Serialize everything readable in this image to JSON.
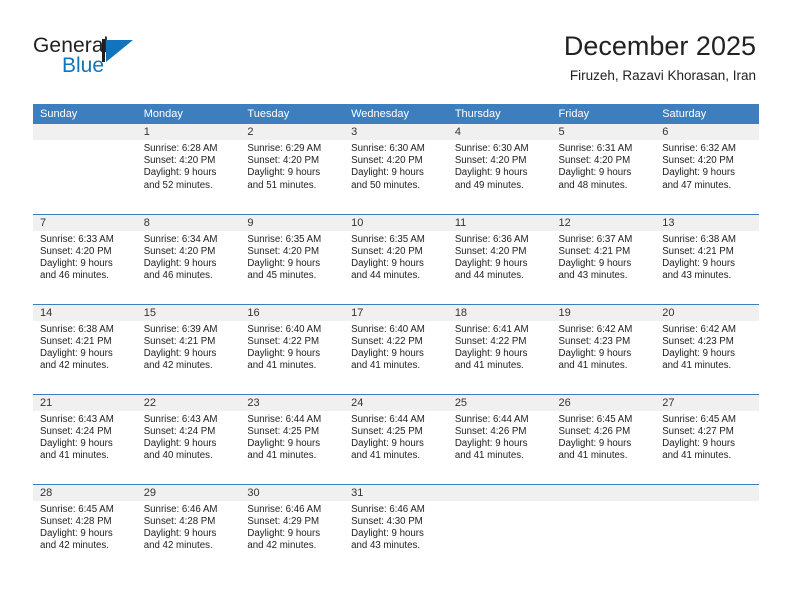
{
  "logo": {
    "word_top": "General",
    "word_bottom": "Blue",
    "brand_color": "#1274bc"
  },
  "header": {
    "title": "December 2025",
    "subtitle": "Firuzeh, Razavi Khorasan, Iran"
  },
  "theme": {
    "header_blue": "#3d7ebf",
    "daynum_band": "#f0f0f0",
    "text": "#222222"
  },
  "calendar": {
    "weekday_headers": [
      "Sunday",
      "Monday",
      "Tuesday",
      "Wednesday",
      "Thursday",
      "Friday",
      "Saturday"
    ],
    "weeks": [
      [
        {
          "day": "",
          "sunrise": "",
          "sunset": "",
          "daylight_1": "",
          "daylight_2": ""
        },
        {
          "day": "1",
          "sunrise": "Sunrise: 6:28 AM",
          "sunset": "Sunset: 4:20 PM",
          "daylight_1": "Daylight: 9 hours",
          "daylight_2": "and 52 minutes."
        },
        {
          "day": "2",
          "sunrise": "Sunrise: 6:29 AM",
          "sunset": "Sunset: 4:20 PM",
          "daylight_1": "Daylight: 9 hours",
          "daylight_2": "and 51 minutes."
        },
        {
          "day": "3",
          "sunrise": "Sunrise: 6:30 AM",
          "sunset": "Sunset: 4:20 PM",
          "daylight_1": "Daylight: 9 hours",
          "daylight_2": "and 50 minutes."
        },
        {
          "day": "4",
          "sunrise": "Sunrise: 6:30 AM",
          "sunset": "Sunset: 4:20 PM",
          "daylight_1": "Daylight: 9 hours",
          "daylight_2": "and 49 minutes."
        },
        {
          "day": "5",
          "sunrise": "Sunrise: 6:31 AM",
          "sunset": "Sunset: 4:20 PM",
          "daylight_1": "Daylight: 9 hours",
          "daylight_2": "and 48 minutes."
        },
        {
          "day": "6",
          "sunrise": "Sunrise: 6:32 AM",
          "sunset": "Sunset: 4:20 PM",
          "daylight_1": "Daylight: 9 hours",
          "daylight_2": "and 47 minutes."
        }
      ],
      [
        {
          "day": "7",
          "sunrise": "Sunrise: 6:33 AM",
          "sunset": "Sunset: 4:20 PM",
          "daylight_1": "Daylight: 9 hours",
          "daylight_2": "and 46 minutes."
        },
        {
          "day": "8",
          "sunrise": "Sunrise: 6:34 AM",
          "sunset": "Sunset: 4:20 PM",
          "daylight_1": "Daylight: 9 hours",
          "daylight_2": "and 46 minutes."
        },
        {
          "day": "9",
          "sunrise": "Sunrise: 6:35 AM",
          "sunset": "Sunset: 4:20 PM",
          "daylight_1": "Daylight: 9 hours",
          "daylight_2": "and 45 minutes."
        },
        {
          "day": "10",
          "sunrise": "Sunrise: 6:35 AM",
          "sunset": "Sunset: 4:20 PM",
          "daylight_1": "Daylight: 9 hours",
          "daylight_2": "and 44 minutes."
        },
        {
          "day": "11",
          "sunrise": "Sunrise: 6:36 AM",
          "sunset": "Sunset: 4:20 PM",
          "daylight_1": "Daylight: 9 hours",
          "daylight_2": "and 44 minutes."
        },
        {
          "day": "12",
          "sunrise": "Sunrise: 6:37 AM",
          "sunset": "Sunset: 4:21 PM",
          "daylight_1": "Daylight: 9 hours",
          "daylight_2": "and 43 minutes."
        },
        {
          "day": "13",
          "sunrise": "Sunrise: 6:38 AM",
          "sunset": "Sunset: 4:21 PM",
          "daylight_1": "Daylight: 9 hours",
          "daylight_2": "and 43 minutes."
        }
      ],
      [
        {
          "day": "14",
          "sunrise": "Sunrise: 6:38 AM",
          "sunset": "Sunset: 4:21 PM",
          "daylight_1": "Daylight: 9 hours",
          "daylight_2": "and 42 minutes."
        },
        {
          "day": "15",
          "sunrise": "Sunrise: 6:39 AM",
          "sunset": "Sunset: 4:21 PM",
          "daylight_1": "Daylight: 9 hours",
          "daylight_2": "and 42 minutes."
        },
        {
          "day": "16",
          "sunrise": "Sunrise: 6:40 AM",
          "sunset": "Sunset: 4:22 PM",
          "daylight_1": "Daylight: 9 hours",
          "daylight_2": "and 41 minutes."
        },
        {
          "day": "17",
          "sunrise": "Sunrise: 6:40 AM",
          "sunset": "Sunset: 4:22 PM",
          "daylight_1": "Daylight: 9 hours",
          "daylight_2": "and 41 minutes."
        },
        {
          "day": "18",
          "sunrise": "Sunrise: 6:41 AM",
          "sunset": "Sunset: 4:22 PM",
          "daylight_1": "Daylight: 9 hours",
          "daylight_2": "and 41 minutes."
        },
        {
          "day": "19",
          "sunrise": "Sunrise: 6:42 AM",
          "sunset": "Sunset: 4:23 PM",
          "daylight_1": "Daylight: 9 hours",
          "daylight_2": "and 41 minutes."
        },
        {
          "day": "20",
          "sunrise": "Sunrise: 6:42 AM",
          "sunset": "Sunset: 4:23 PM",
          "daylight_1": "Daylight: 9 hours",
          "daylight_2": "and 41 minutes."
        }
      ],
      [
        {
          "day": "21",
          "sunrise": "Sunrise: 6:43 AM",
          "sunset": "Sunset: 4:24 PM",
          "daylight_1": "Daylight: 9 hours",
          "daylight_2": "and 41 minutes."
        },
        {
          "day": "22",
          "sunrise": "Sunrise: 6:43 AM",
          "sunset": "Sunset: 4:24 PM",
          "daylight_1": "Daylight: 9 hours",
          "daylight_2": "and 40 minutes."
        },
        {
          "day": "23",
          "sunrise": "Sunrise: 6:44 AM",
          "sunset": "Sunset: 4:25 PM",
          "daylight_1": "Daylight: 9 hours",
          "daylight_2": "and 41 minutes."
        },
        {
          "day": "24",
          "sunrise": "Sunrise: 6:44 AM",
          "sunset": "Sunset: 4:25 PM",
          "daylight_1": "Daylight: 9 hours",
          "daylight_2": "and 41 minutes."
        },
        {
          "day": "25",
          "sunrise": "Sunrise: 6:44 AM",
          "sunset": "Sunset: 4:26 PM",
          "daylight_1": "Daylight: 9 hours",
          "daylight_2": "and 41 minutes."
        },
        {
          "day": "26",
          "sunrise": "Sunrise: 6:45 AM",
          "sunset": "Sunset: 4:26 PM",
          "daylight_1": "Daylight: 9 hours",
          "daylight_2": "and 41 minutes."
        },
        {
          "day": "27",
          "sunrise": "Sunrise: 6:45 AM",
          "sunset": "Sunset: 4:27 PM",
          "daylight_1": "Daylight: 9 hours",
          "daylight_2": "and 41 minutes."
        }
      ],
      [
        {
          "day": "28",
          "sunrise": "Sunrise: 6:45 AM",
          "sunset": "Sunset: 4:28 PM",
          "daylight_1": "Daylight: 9 hours",
          "daylight_2": "and 42 minutes."
        },
        {
          "day": "29",
          "sunrise": "Sunrise: 6:46 AM",
          "sunset": "Sunset: 4:28 PM",
          "daylight_1": "Daylight: 9 hours",
          "daylight_2": "and 42 minutes."
        },
        {
          "day": "30",
          "sunrise": "Sunrise: 6:46 AM",
          "sunset": "Sunset: 4:29 PM",
          "daylight_1": "Daylight: 9 hours",
          "daylight_2": "and 42 minutes."
        },
        {
          "day": "31",
          "sunrise": "Sunrise: 6:46 AM",
          "sunset": "Sunset: 4:30 PM",
          "daylight_1": "Daylight: 9 hours",
          "daylight_2": "and 43 minutes."
        },
        {
          "day": "",
          "sunrise": "",
          "sunset": "",
          "daylight_1": "",
          "daylight_2": ""
        },
        {
          "day": "",
          "sunrise": "",
          "sunset": "",
          "daylight_1": "",
          "daylight_2": ""
        },
        {
          "day": "",
          "sunrise": "",
          "sunset": "",
          "daylight_1": "",
          "daylight_2": ""
        }
      ]
    ]
  }
}
